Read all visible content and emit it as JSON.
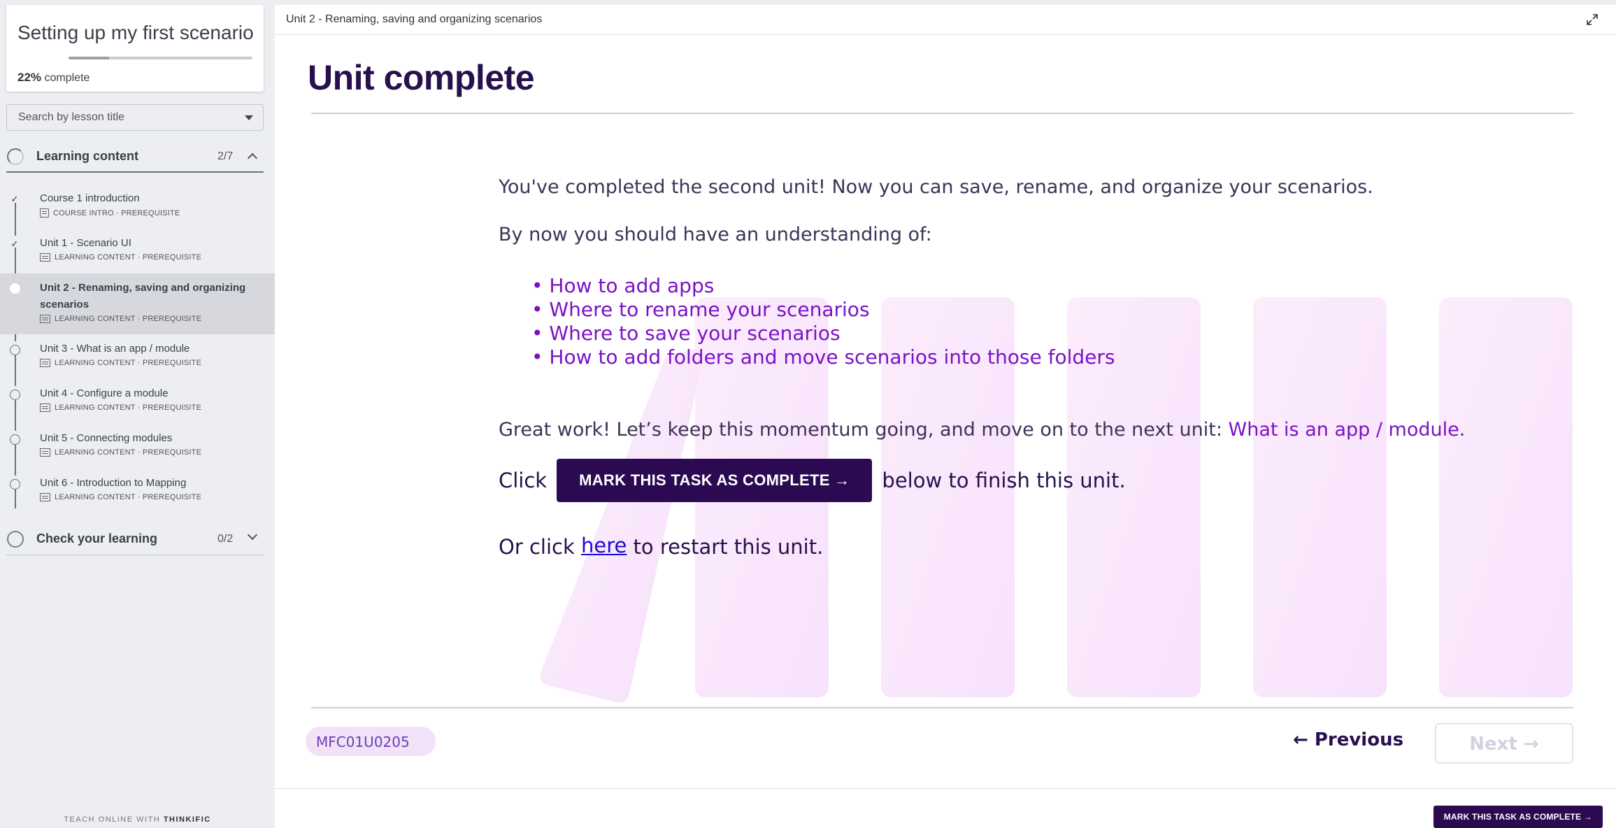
{
  "sidebar": {
    "course_title": "Setting up my first scenario",
    "progress_percent": "22%",
    "progress_value": 0.22,
    "progress_suffix": "complete",
    "search_placeholder": "Search by lesson title",
    "chapters": [
      {
        "label": "Learning content",
        "count": "2/7",
        "lessons": [
          {
            "title": "Course 1 introduction",
            "meta": "COURSE INTRO · PREREQUISITE",
            "status": "done"
          },
          {
            "title": "Unit 1 - Scenario UI",
            "meta": "LEARNING CONTENT · PREREQUISITE",
            "status": "done"
          },
          {
            "title": "Unit 2 - Renaming, saving and organizing scenarios",
            "meta": "LEARNING CONTENT · PREREQUISITE",
            "status": "current"
          },
          {
            "title": "Unit 3 - What is an app / module",
            "meta": "LEARNING CONTENT · PREREQUISITE",
            "status": "open"
          },
          {
            "title": "Unit 4 - Configure a module",
            "meta": "LEARNING CONTENT · PREREQUISITE",
            "status": "open"
          },
          {
            "title": "Unit 5 - Connecting modules",
            "meta": "LEARNING CONTENT · PREREQUISITE",
            "status": "open"
          },
          {
            "title": "Unit 6 - Introduction to Mapping",
            "meta": "LEARNING CONTENT · PREREQUISITE",
            "status": "open"
          }
        ]
      },
      {
        "label": "Check your learning",
        "count": "0/2",
        "lessons": []
      }
    ],
    "powered_prefix": "TEACH ONLINE WITH",
    "powered_brand": "THINKIFIC"
  },
  "topbar": {
    "breadcrumb": "Unit 2 - Renaming, saving and organizing scenarios"
  },
  "main": {
    "heading": "Unit complete",
    "intro": "You've completed the second unit! Now you can save, rename, and organize your scenarios.",
    "understanding": "By now you should have an understanding of:",
    "bullets": [
      "How to add apps",
      "Where to rename your scenarios",
      "Where to save your scenarios",
      "How to add folders and move scenarios into those folders"
    ],
    "great_prefix": "Great work! Let’s keep this momentum going, and move on to the next unit: ",
    "great_link": "What is an app / module",
    "great_suffix": ".",
    "click_prefix": "Click",
    "cta_label": "MARK THIS TASK AS COMPLETE →",
    "click_suffix": "below to finish this unit.",
    "restart_prefix": "Or click ",
    "restart_link": "here",
    "restart_suffix": " to restart this unit.",
    "code": "MFC01U0205",
    "prev_label": "← Previous",
    "next_label": "Next →"
  },
  "footer": {
    "cta_label": "MARK THIS TASK AS COMPLETE →"
  },
  "colors": {
    "brand": "#2b0a52",
    "accent": "#7a12c6",
    "heading": "#27104e"
  }
}
